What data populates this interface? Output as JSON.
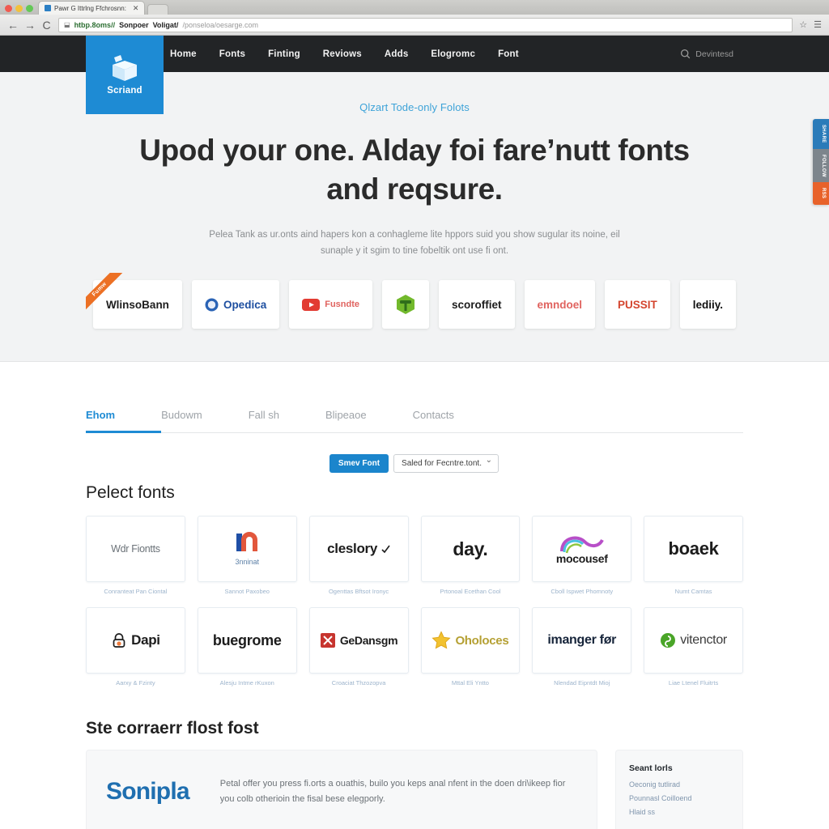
{
  "browser": {
    "tab_title": "Pawr G Ittrlng Ffchrosnn:",
    "tab_close": "✕",
    "url": {
      "scheme": "htbp.8oms//",
      "host_a": "Sonpoer",
      "host_b": "Voligat/",
      "path": "/ponseloa/oesarge.com"
    },
    "star_icon": "☆",
    "menu_icon": "☰",
    "back_icon": "←",
    "forward_icon": "→",
    "reload_icon": "C",
    "lock_icon": "⬓"
  },
  "site": {
    "logo_text": "Scriand",
    "nav": [
      {
        "label": "Home"
      },
      {
        "label": "Fonts"
      },
      {
        "label": "Finting"
      },
      {
        "label": "Reviows"
      },
      {
        "label": "Adds"
      },
      {
        "label": "Elogromc"
      },
      {
        "label": "Font"
      }
    ],
    "search_label": "Devintesd"
  },
  "hero": {
    "eyebrow": "Qlzart Tode-only Folots",
    "title": "Upod your one. Alday foi fare’nutt fonts and reqsure.",
    "subtitle": "Pelea Tank as ur.onts aind hapers kon a conhagleme lite hppors suid you show sugular its noine, eil sunaple y it sgim to tine fobeltik ont use fi ont.",
    "ribbon_label": "Fumw",
    "brands": [
      {
        "label": "WlinsoBann",
        "icon": "none",
        "color": "#1d1d1d",
        "ribbon": true
      },
      {
        "label": "Opedica",
        "icon": "circle-badge",
        "color": "#1e4fa0",
        "ribbon": false
      },
      {
        "label": "Fusndte",
        "icon": "play-rect",
        "color": "#e23b32",
        "ribbon": false
      },
      {
        "label": "",
        "icon": "tree-hex",
        "color": "#6ab023",
        "ribbon": false
      },
      {
        "label": "scoroffiet",
        "icon": "none",
        "color": "#1d1d1d",
        "ribbon": false
      },
      {
        "label": "emndoel",
        "icon": "none",
        "color": "#e0635f",
        "ribbon": false
      },
      {
        "label": "PUSSIT",
        "icon": "swirl",
        "color": "#d4452e",
        "ribbon": false
      },
      {
        "label": "lediiy.",
        "icon": "none",
        "color": "#111111",
        "ribbon": false
      }
    ]
  },
  "tabs": [
    {
      "label": "Ehom",
      "active": true
    },
    {
      "label": "Budowm",
      "active": false
    },
    {
      "label": "Fall sh",
      "active": false
    },
    {
      "label": "Blipeaoe",
      "active": false
    },
    {
      "label": "Contacts",
      "active": false
    }
  ],
  "section": {
    "title": "Pelect fonts",
    "primary_button": "Smev Font",
    "select_value": "Saled for Fecntre.tont."
  },
  "font_cards": [
    {
      "logo": "Wdr Fiontts",
      "style": "light",
      "sub": "",
      "caption": "Conranteat Pan Ciontal",
      "icon": "none",
      "color": "#6b7278"
    },
    {
      "logo": "",
      "style": "bold",
      "sub": "3nninat",
      "caption": "Sannot Paxobeo",
      "icon": "n-mark",
      "color": "#1f4fa6"
    },
    {
      "logo": "cleslory",
      "style": "bold",
      "sub": "",
      "caption": "Ogenttas Bftsot Ironyc",
      "icon": "tick",
      "color": "#1c1c1c"
    },
    {
      "logo": "day.",
      "style": "bold",
      "sub": "",
      "caption": "Prtonoal Ecethan Cool",
      "icon": "none",
      "color": "#121212"
    },
    {
      "logo": "mocousef",
      "style": "bold",
      "sub": "",
      "caption": "Cboll Ispwet Phomnoty",
      "icon": "swoosh",
      "color": "#1c1c1c"
    },
    {
      "logo": "boaek",
      "style": "bold",
      "sub": "",
      "caption": "Numt Camtas",
      "icon": "none",
      "color": "#111111"
    },
    {
      "logo": "Dapi",
      "style": "bold",
      "sub": "",
      "caption": "Aarxy & Fzinty",
      "icon": "lock",
      "color": "#1c1c1c"
    },
    {
      "logo": "buegrome",
      "style": "bold",
      "sub": "",
      "caption": "Alesju Intme rKuxon",
      "icon": "none",
      "color": "#141414"
    },
    {
      "logo": "GeDansgm",
      "style": "bold",
      "sub": "",
      "caption": "Croaciat Thzozopva",
      "icon": "red-square",
      "color": "#1c1c1c"
    },
    {
      "logo": "Oholoces",
      "style": "bold",
      "sub": "",
      "caption": "Mttal Eli Yntto",
      "icon": "star",
      "color": "#b5a033"
    },
    {
      "logo": "imanger før",
      "style": "bold",
      "sub": "",
      "caption": "Nlendad Eipntdt Mioj",
      "icon": "none",
      "color": "#16243a"
    },
    {
      "logo": "vitenctor",
      "style": "bold",
      "sub": "",
      "caption": "Liae Ltenel Fluitrts",
      "icon": "green-circle",
      "color": "#3b3b3b"
    }
  ],
  "bottom": {
    "title": "Ste corraerr flost fost",
    "feature_logo": "Sonipla",
    "feature_text": "Petal offer you press fi.orts a ouathis, builo you keps anal nfent in the doen dri\\ikeep fior you colb otherioin the fisal bese elegporly.",
    "side_title": "Seant lorls",
    "side_links": [
      {
        "label": "Oeconig tutlirad"
      },
      {
        "label": "Pounnasl Coilloend"
      },
      {
        "label": "Hlaid ss"
      }
    ]
  },
  "share_widget": [
    {
      "label": "SHARE",
      "tone": "b"
    },
    {
      "label": "FOLLOW",
      "tone": "g"
    },
    {
      "label": "RSS",
      "tone": "o"
    }
  ]
}
